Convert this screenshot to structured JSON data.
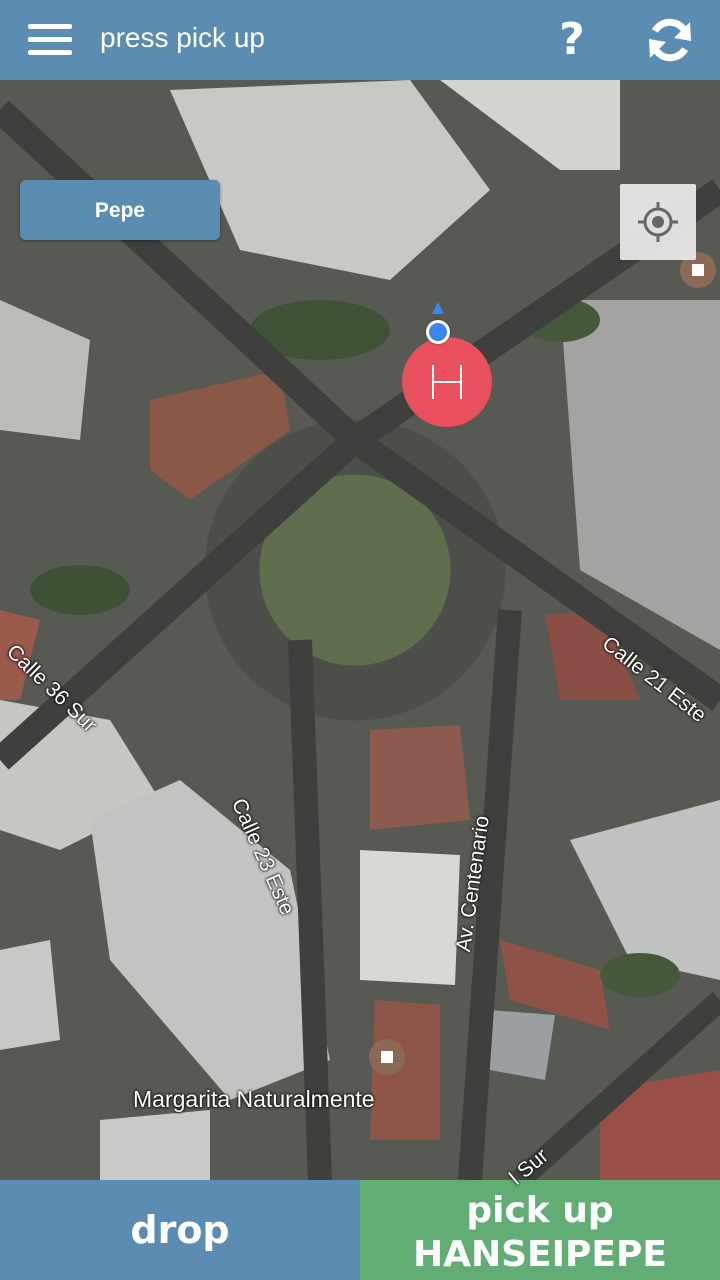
{
  "header": {
    "title": "press pick up",
    "help_label": "?"
  },
  "map": {
    "user_button_label": "Pepe",
    "hospital_marker_letter": "H",
    "streets": {
      "calle_36_sur": "Calle 36 Sur",
      "calle_21_este": "Calle 21 Este",
      "calle_23_este": "Calle 23 Este",
      "av_centenario": "Av. Centenario",
      "sur_fragment": "l Sur"
    },
    "poi_label": "Margarita Naturalmente"
  },
  "bottom_bar": {
    "drop_label": "drop",
    "pickup_line1": "pick up",
    "pickup_line2": "HANSEIPEPE"
  },
  "colors": {
    "primary": "#5a8db1",
    "pickup_green": "#62ad74",
    "hospital_red": "#e8505b",
    "location_blue": "#3a86f0"
  }
}
